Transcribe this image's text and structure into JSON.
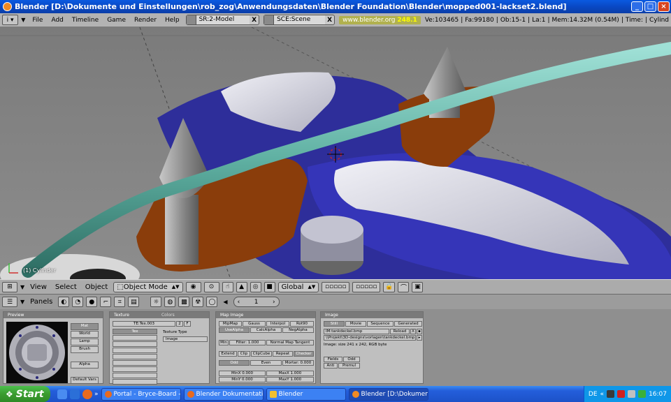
{
  "window": {
    "title": "Blender [D:\\Dokumente und Einstellungen\\rob_zog\\Anwendungsdaten\\Blender Foundation\\Blender\\mopped001-lackset2.blend]",
    "minimize": "_",
    "maximize": "□",
    "close": "×"
  },
  "menubar": {
    "menus": [
      "File",
      "Add",
      "Timeline",
      "Game",
      "Render",
      "Help"
    ],
    "screen": "SR:2-Model",
    "scene": "SCE:Scene",
    "website": "www.blender.org",
    "version": "248.1",
    "stats": [
      "Ve:103465",
      "Fa:99180",
      "Ob:15-1",
      "La:1",
      "Mem:14.32M (0.54M)",
      "Time:",
      "Cylind"
    ],
    "close_x": "X"
  },
  "viewport": {
    "object_label": "(1) Cylinder"
  },
  "view3d_header": {
    "menus": [
      "View",
      "Select",
      "Object"
    ],
    "mode": "Object Mode",
    "orientation": "Global"
  },
  "buttons_header": {
    "panels_label": "Panels",
    "frame": "1"
  },
  "panels": {
    "preview": {
      "title": "Preview",
      "buttons": [
        "Mat",
        "World",
        "Lamp",
        "Brush",
        "Alpha"
      ],
      "default_vars": "Default Vars"
    },
    "texture": {
      "tabs": [
        "Texture",
        "Colors"
      ],
      "name": "TE:Tex.003",
      "users": "2",
      "fake": "F",
      "list_item": "Tex",
      "type_label": "Texture Type",
      "type_value": "Image"
    },
    "map_image": {
      "title": "Map Image",
      "row1": [
        "MipMap",
        "Gauss",
        "Interpol",
        "Rot90"
      ],
      "row2": [
        "UseAlpha",
        "CalcAlpha",
        "NegAlpha"
      ],
      "min_label": "Min",
      "filter": "Filter: 1.000",
      "normal_map": "Normal Map Tangent",
      "row4": [
        "Extend",
        "Clip",
        "ClipCube",
        "Repeat",
        "Checker"
      ],
      "row5": [
        "Odd",
        "Even",
        "Mortar: 0.000"
      ],
      "minx": "MinX 0.000",
      "maxx": "MaxX 1.000",
      "miny": "MinY 0.000",
      "maxy": "MaxY 1.000"
    },
    "image": {
      "title": "Image",
      "tabs": [
        "Still",
        "Movie",
        "Sequence",
        "Generated"
      ],
      "file1": "IM:tankdeckel.bmp",
      "reload": "Reload",
      "x_label": "X",
      "file2": "\\\\Projekt\\3D-designs\\vorlagen\\tankdeckel.bmp",
      "info": "Image: size 241 x 242, RGB byte",
      "fields": "Fields",
      "odd": "Odd",
      "anti": "Anti",
      "premul": "Premul"
    }
  },
  "taskbar": {
    "start": "Start",
    "tasks": [
      "Portal - Bryce-Board -...",
      "Blender Dokumentati...",
      "Blender",
      "Blender [D:\\Dokumen..."
    ],
    "lang": "DE",
    "clock": "16:07"
  },
  "colors": {
    "viewport_bg": "#7f7f7f",
    "body_blue": "#2f2f9c",
    "handlebar_teal": "#63b5a6",
    "bracket_orange": "#8a3d0b",
    "xp_blue": "#245edb",
    "start_green": "#3a9c2f"
  }
}
